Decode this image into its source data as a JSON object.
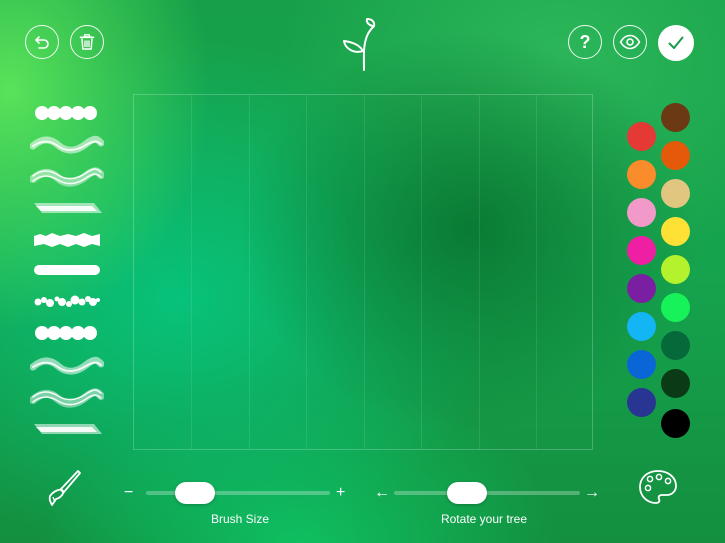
{
  "toolbar": {
    "help_label": "?"
  },
  "brushes": [
    {
      "name": "dots"
    },
    {
      "name": "wave-soft"
    },
    {
      "name": "wave-double"
    },
    {
      "name": "chisel"
    },
    {
      "name": "rough"
    },
    {
      "name": "solid"
    },
    {
      "name": "splatter"
    },
    {
      "name": "dots"
    },
    {
      "name": "wave-soft"
    },
    {
      "name": "wave-double"
    },
    {
      "name": "chisel"
    }
  ],
  "palette": {
    "left": [
      "#e53935",
      "#fb8c2b",
      "#f19ac9",
      "#ef1fa4",
      "#7b1fa2",
      "#14b5f5",
      "#0a66d6",
      "#283593"
    ],
    "right": [
      "#6b3a14",
      "#e55a0a",
      "#e1c680",
      "#ffe135",
      "#b3f22c",
      "#18f25a",
      "#06693a",
      "#0b3b16",
      "#000000"
    ]
  },
  "brush_size": {
    "label": "Brush Size",
    "minus": "−",
    "plus": "+",
    "value": 0.2
  },
  "rotate": {
    "label": "Rotate your tree",
    "left_arrow": "←",
    "right_arrow": "→",
    "value": 0.36
  },
  "icons": {
    "undo": "undo-icon",
    "trash": "trash-icon",
    "logo": "sprout-icon",
    "help": "help-icon",
    "preview": "eye-icon",
    "confirm": "checkmark-icon",
    "brush_tool": "paintbrush-icon",
    "palette_tool": "palette-icon"
  },
  "colors": {
    "foreground": "#ffffff",
    "confirm_check": "#1a9a4a"
  }
}
